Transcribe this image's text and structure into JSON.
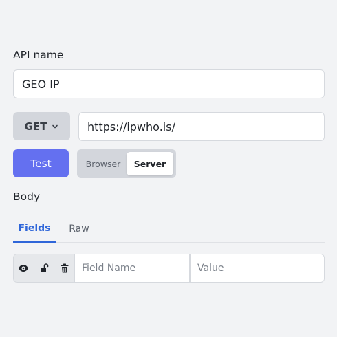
{
  "api_name": {
    "label": "API name",
    "value": "GEO IP"
  },
  "request": {
    "method": "GET",
    "url": "https://ipwho.is/"
  },
  "actions": {
    "test_label": "Test",
    "environment_options": [
      "Browser",
      "Server"
    ],
    "selected_environment": "Server"
  },
  "body": {
    "label": "Body",
    "tabs": [
      "Fields",
      "Raw"
    ],
    "active_tab": "Fields",
    "fields_row": {
      "icons": [
        "eye-icon",
        "unlock-icon",
        "trash-icon"
      ],
      "name_placeholder": "Field Name",
      "value_placeholder": "Value"
    }
  },
  "colors": {
    "background": "#f2f3f5",
    "accent": "#6470f0",
    "tab_active": "#2f66d9"
  }
}
